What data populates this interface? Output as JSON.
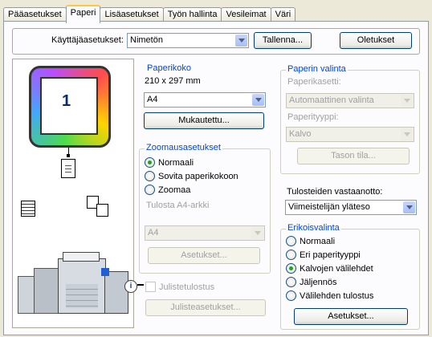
{
  "tabs": [
    "Pääasetukset",
    "Paperi",
    "Lisäasetukset",
    "Työn hallinta",
    "Vesileimat",
    "Väri"
  ],
  "active_tab": "Paperi",
  "user_settings": {
    "label": "Käyttäjäasetukset:",
    "value": "Nimetön",
    "save_label": "Tallenna...",
    "defaults_label": "Oletukset"
  },
  "preview": {
    "copies": "1"
  },
  "paper_size": {
    "title": "Paperikoko",
    "dims": "210 x 297 mm",
    "value": "A4",
    "custom_label": "Mukautettu..."
  },
  "zoom": {
    "title": "Zoomausasetukset",
    "options": [
      "Normaali",
      "Sovita paperikokoon",
      "Zoomaa"
    ],
    "selected": "Normaali",
    "print_label": "Tulosta A4-arkki",
    "print_value": "A4",
    "settings_label": "Asetukset..."
  },
  "poster": {
    "label": "Julistetulostus",
    "settings_label": "Julisteasetukset..."
  },
  "paper_select": {
    "title": "Paperin valinta",
    "tray_label": "Paperikasetti:",
    "tray_value": "Automaattinen valinta",
    "type_label": "Paperityyppi:",
    "type_value": "Kalvo",
    "tray_status_label": "Tason tila..."
  },
  "output": {
    "label": "Tulosteiden vastaanotto:",
    "value": "Viimeistelijän yläteso"
  },
  "special": {
    "title": "Erikoisvalinta",
    "options": [
      "Normaali",
      "Eri paperityyppi",
      "Kalvojen välilehdet",
      "Jäljennös",
      "Välilehden tulostus"
    ],
    "selected": "Kalvojen välilehdet",
    "settings_label": "Asetukset..."
  },
  "colors": {
    "accent": "#0046d5",
    "tab_highlight": "#ffc83c"
  }
}
